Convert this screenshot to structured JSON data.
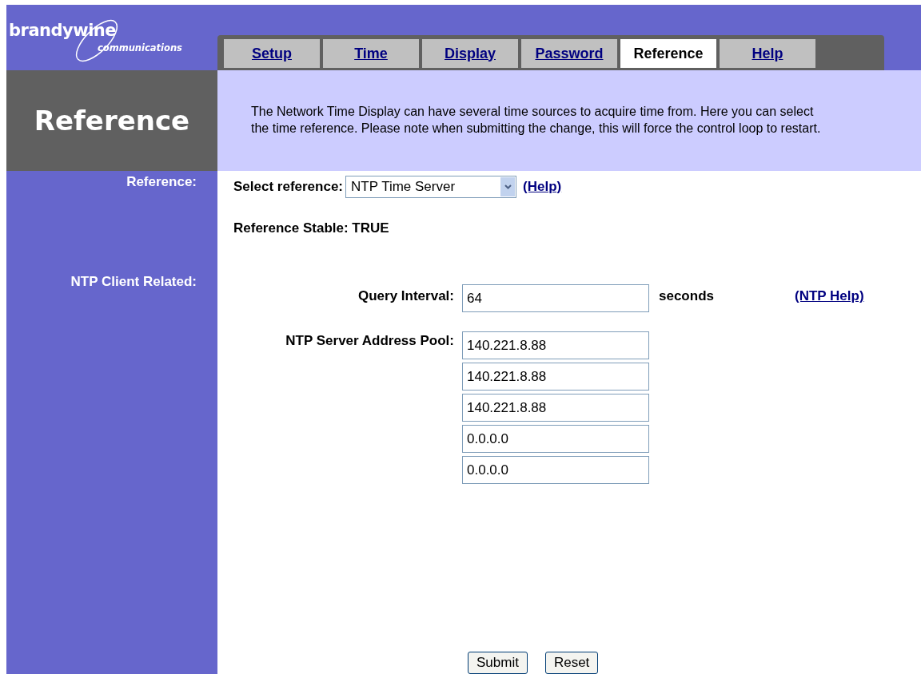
{
  "logo": {
    "name": "brandywine",
    "tagline": "communications"
  },
  "tabs": [
    {
      "label": "Setup",
      "selected": false
    },
    {
      "label": "Time",
      "selected": false
    },
    {
      "label": "Display",
      "selected": false
    },
    {
      "label": "Password",
      "selected": false
    },
    {
      "label": "Reference",
      "selected": true
    },
    {
      "label": "Help",
      "selected": false
    }
  ],
  "page_title": "Reference",
  "description": "The Network Time Display can have several time sources to acquire time from. Here you can select the time reference. Please note when submitting the change, this will force the control loop to restart.",
  "reference_section": {
    "label": "Reference:",
    "select_label": "Select reference:",
    "select_value": "NTP Time Server",
    "help_link": "(Help)",
    "status": "Reference Stable: TRUE"
  },
  "ntp_section": {
    "label": "NTP Client Related:",
    "query_label": "Query Interval:",
    "query_value": "64",
    "query_unit": "seconds",
    "help_link": "(NTP Help)",
    "pool_label": "NTP Server Address Pool:",
    "pool": [
      "140.221.8.88",
      "140.221.8.88",
      "140.221.8.88",
      "0.0.0.0",
      "0.0.0.0"
    ]
  },
  "buttons": [
    "Submit",
    "Reset"
  ]
}
